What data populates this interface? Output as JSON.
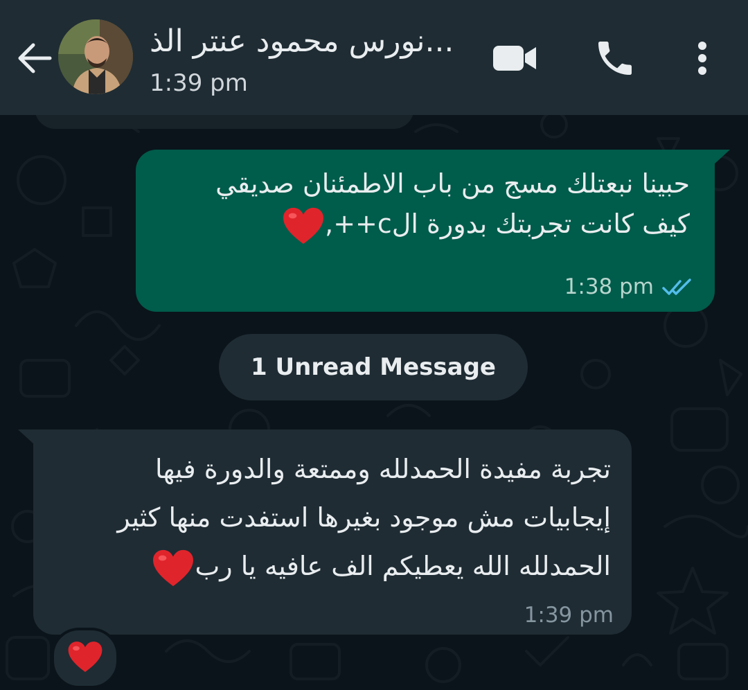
{
  "header": {
    "contact_name": "نورس محمود عنتر الذ...",
    "last_seen": "1:39 pm",
    "icons": [
      "back-arrow-icon",
      "video-call-icon",
      "phone-icon",
      "more-vert-icon"
    ]
  },
  "messages": [
    {
      "direction": "outgoing",
      "lines": [
        "حبينا نبعتلك مسج من باب الاطمئنان صديقي",
        "كيف كانت تجربتك بدورة الc++,"
      ],
      "emoji": "❤️",
      "time": "1:38 pm",
      "status": "read"
    },
    {
      "direction": "incoming",
      "lines": [
        "تجربة مفيدة الحمدلله وممتعة والدورة فيها",
        "إيجابيات مش موجود بغيرها استفدت منها كثير",
        "الحمدلله الله يعطيكم الف عافيه يا رب"
      ],
      "emoji": "❤️",
      "time": "1:39 pm",
      "reaction": "❤️"
    }
  ],
  "unread_divider": "1 Unread Message",
  "colors": {
    "background": "#0b141a",
    "header": "#1f2c34",
    "outgoing_bubble": "#005c4b",
    "incoming_bubble": "#1f2c34",
    "read_ticks": "#53bdeb",
    "heart": "#e0242b"
  }
}
